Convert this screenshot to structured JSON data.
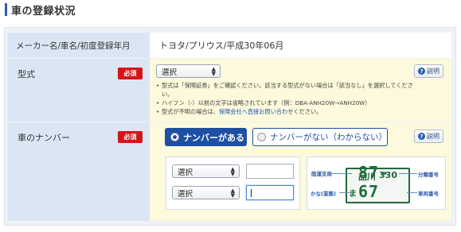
{
  "section_title": "車の登録状況",
  "maker": {
    "label": "メーカー名/車名/初度登録年月",
    "value": "トヨタ/プリウス/平成30年06月"
  },
  "model": {
    "label": "型式",
    "required_badge": "必須",
    "help_label": "説明",
    "select_value": "選択",
    "notes": [
      "型式は「保険証券」をご確認ください。該当する型式がない場合は「該当なし」を選択してください。",
      "ハイフン（-）以前の文字は省略されています（例：DBA-ANH20W→ANH20W）"
    ],
    "note3_prefix": "型式が不明の場合は、",
    "note3_link": "保険会社へ直接お問い合わせ",
    "note3_suffix": "ください。"
  },
  "plate": {
    "label": "車のナンバー",
    "required_badge": "必須",
    "help_label": "説明",
    "option_has": "ナンバーがある",
    "option_none": "ナンバーがない（わからない）",
    "selected_option": "ナンバーがある",
    "select1_value": "選択",
    "select2_value": "選択",
    "input1_value": "",
    "input2_value": "",
    "example": {
      "region": "品川",
      "class_number": "330",
      "kana": "ま",
      "serial": "87-67",
      "label_region": "陸運支局",
      "label_kana": "かな(業態)",
      "label_class": "分類番号",
      "label_serial": "車両番号"
    }
  },
  "colors": {
    "accent": "#1d4fa3",
    "required": "#d6131b",
    "label_bg": "#dbe6f4",
    "value_bg": "#fcf9dc",
    "plate_green": "#1f6b3b"
  }
}
